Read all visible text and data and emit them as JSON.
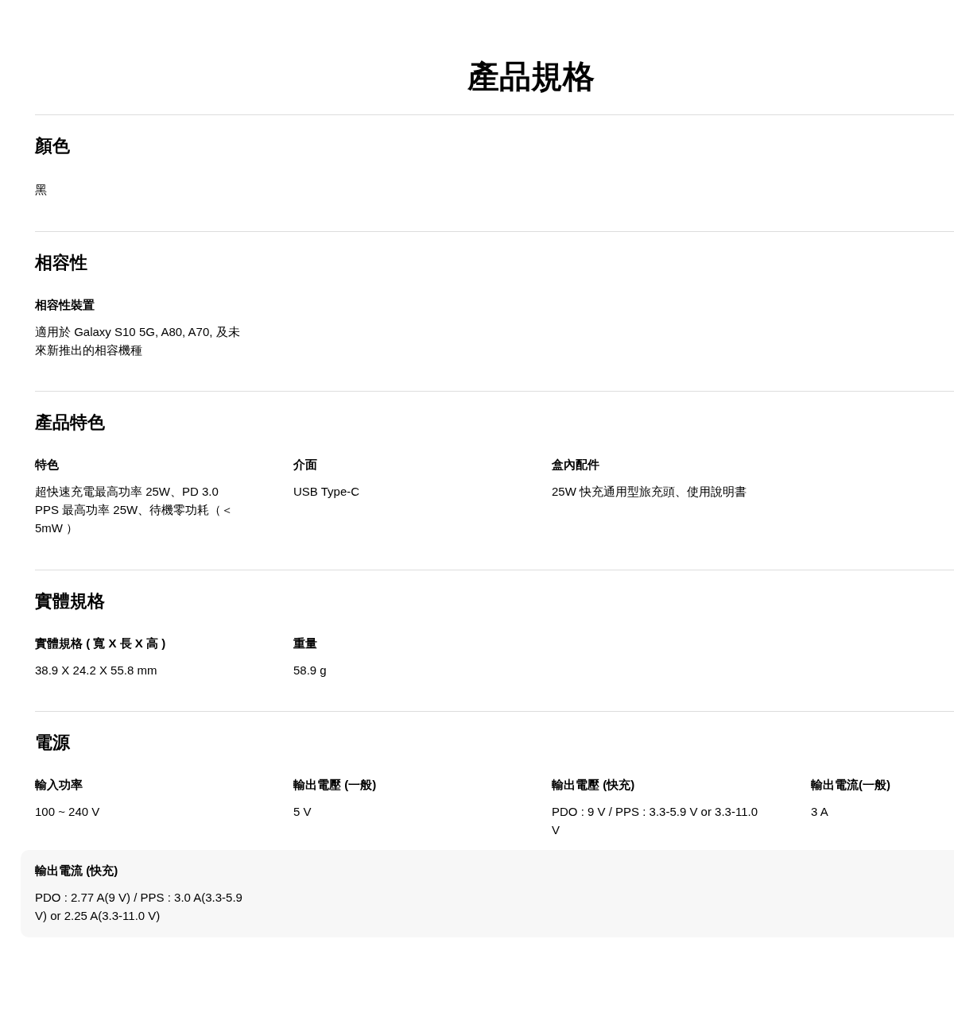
{
  "title": "產品規格",
  "sections": [
    {
      "heading": "顏色",
      "items": [
        {
          "value": "黑",
          "highlighted": false
        }
      ]
    },
    {
      "heading": "相容性",
      "items": [
        {
          "label": "相容性裝置",
          "value": "適用於 Galaxy S10 5G, A80, A70, 及未來新推出的相容機種",
          "highlighted": false
        }
      ]
    },
    {
      "heading": "產品特色",
      "items": [
        {
          "label": "特色",
          "value": "超快速充電最高功率 25W、PD 3.0 PPS 最高功率 25W、待機零功耗（＜5mW ）",
          "highlighted": false
        },
        {
          "label": "介面",
          "value": "USB Type-C",
          "highlighted": false
        },
        {
          "label": "盒內配件",
          "value": "25W 快充通用型旅充頭、使用說明書",
          "highlighted": false
        }
      ]
    },
    {
      "heading": "實體規格",
      "items": [
        {
          "label": "實體規格 ( 寬 X 長 X 高 )",
          "value": "38.9 X 24.2 X 55.8 mm",
          "highlighted": false
        },
        {
          "label": "重量",
          "value": "58.9 g",
          "highlighted": false
        }
      ]
    },
    {
      "heading": "電源",
      "items": [
        {
          "label": "輸入功率",
          "value": "100 ~ 240 V",
          "highlighted": false
        },
        {
          "label": "輸出電壓 (一般)",
          "value": "5 V",
          "highlighted": false
        },
        {
          "label": "輸出電壓 (快充)",
          "value": "PDO : 9 V / PPS : 3.3-5.9 V or 3.3-11.0 V",
          "highlighted": false
        },
        {
          "label": "輸出電流(一般)",
          "value": "3 A",
          "highlighted": false
        },
        {
          "label": "輸出電流 (快充)",
          "value": "PDO : 2.77 A(9 V) / PPS : 3.0 A(3.3-5.9 V) or 2.25 A(3.3-11.0 V)",
          "highlighted": true
        }
      ]
    }
  ]
}
